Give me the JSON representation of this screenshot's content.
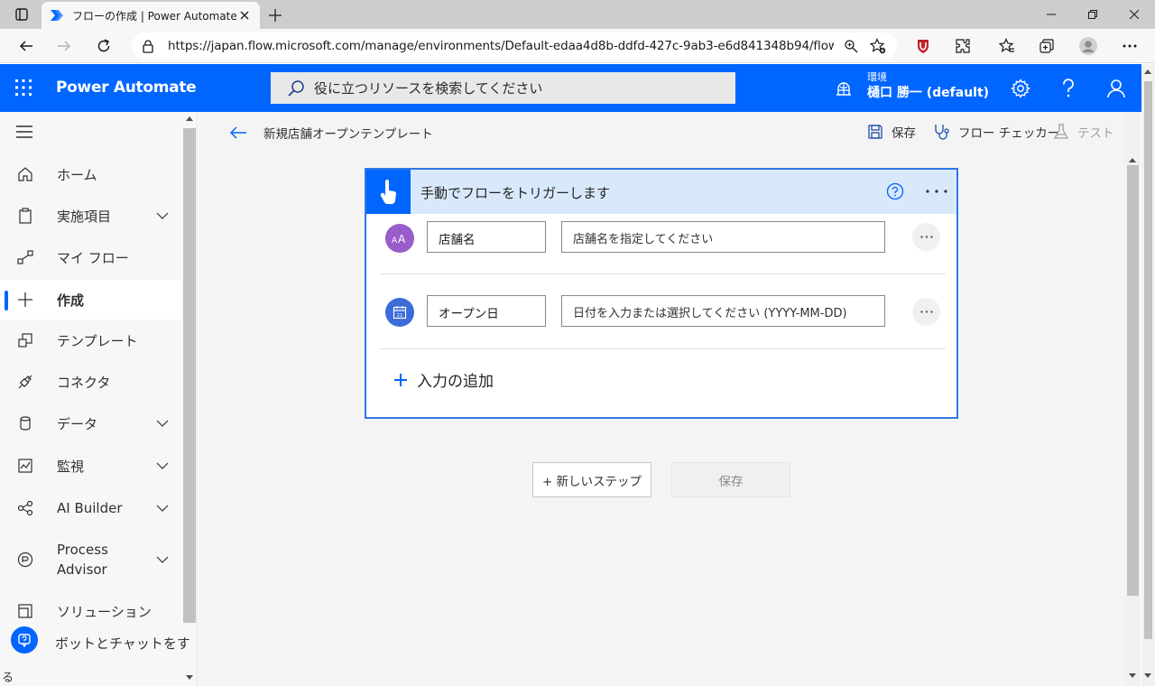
{
  "browser": {
    "tab_title": "フローの作成 | Power Automate",
    "url": "https://japan.flow.microsoft.com/manage/environments/Default-edaa4d8b-ddfd-427c-9ab3-e6d841348b94/flows/n..."
  },
  "header": {
    "brand": "Power Automate",
    "search_placeholder": "役に立つリソースを検索してください",
    "env_label": "環境",
    "env_name": "樋口 勝一 (default)"
  },
  "sidebar": {
    "items": [
      {
        "label": "ホーム",
        "icon": "home-icon"
      },
      {
        "label": "実施項目",
        "icon": "clipboard-icon"
      },
      {
        "label": "マイ フロー",
        "icon": "flow-icon"
      },
      {
        "label": "作成",
        "icon": "plus-icon"
      },
      {
        "label": "テンプレート",
        "icon": "template-icon"
      },
      {
        "label": "コネクタ",
        "icon": "connector-icon"
      },
      {
        "label": "データ",
        "icon": "database-icon"
      },
      {
        "label": "監視",
        "icon": "monitor-icon"
      },
      {
        "label": "AI Builder",
        "icon": "ai-builder-icon"
      },
      {
        "label": "Process",
        "label2": "Advisor",
        "icon": "process-advisor-icon"
      },
      {
        "label": "ソリューション",
        "icon": "solution-icon"
      },
      {
        "label": "ボットとチャットをす",
        "icon": "bot-icon"
      }
    ],
    "clipped_text": "る"
  },
  "toolbar": {
    "flow_name": "新規店舗オープンテンプレート",
    "save": "保存",
    "checker": "フロー チェッカー",
    "test": "テスト"
  },
  "trigger": {
    "title": "手動でフローをトリガーします",
    "inputs": [
      {
        "name": "店舗名",
        "placeholder": "店舗名を指定してください",
        "avatar": "AA"
      },
      {
        "name": "オープン日",
        "placeholder": "日付を入力または選択してください (YYYY-MM-DD)",
        "avatar": "calendar"
      }
    ],
    "add_input": "入力の追加"
  },
  "actions": {
    "new_step": "+ 新しいステップ",
    "save": "保存"
  },
  "colors": {
    "accent": "#0066ff",
    "card_header": "#d9e9fc",
    "text_avatar": "#9a5dcc",
    "date_avatar": "#3b6cd8"
  }
}
